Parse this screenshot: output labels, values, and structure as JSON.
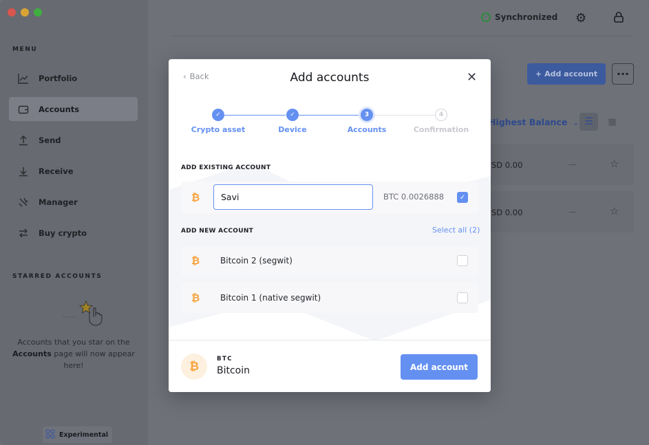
{
  "window": {
    "traffic_colors": [
      "#d8564d",
      "#d9a434",
      "#3fae41"
    ]
  },
  "sidebar": {
    "menu_title": "MENU",
    "items": [
      {
        "label": "Portfolio",
        "icon": "chart-line-icon"
      },
      {
        "label": "Accounts",
        "icon": "wallet-icon",
        "active": true
      },
      {
        "label": "Send",
        "icon": "arrow-up-icon"
      },
      {
        "label": "Receive",
        "icon": "arrow-down-icon"
      },
      {
        "label": "Manager",
        "icon": "tools-icon"
      },
      {
        "label": "Buy crypto",
        "icon": "exchange-icon"
      }
    ],
    "starred_title": "STARRED ACCOUNTS",
    "starred_text_1": "Accounts that you star on the",
    "starred_text_bold": "Accounts",
    "starred_text_2": "page will now appear here!",
    "experimental": "Experimental"
  },
  "topbar": {
    "sync_label": "Synchronized",
    "gear_icon": "gear-icon",
    "lock_icon": "lock-icon"
  },
  "accounts_page": {
    "add_account_label": "Add account",
    "more_label": "···",
    "sort_label": "Highest Balance",
    "rows": [
      {
        "balance": "SD 0.00",
        "change": "—"
      },
      {
        "balance": "SD 0.00",
        "change": "—"
      }
    ]
  },
  "modal": {
    "back_label": "Back",
    "title": "Add accounts",
    "steps": [
      {
        "label": "Crypto asset",
        "state": "done",
        "mark": "✓"
      },
      {
        "label": "Device",
        "state": "done",
        "mark": "✓"
      },
      {
        "label": "Accounts",
        "state": "current",
        "mark": "3"
      },
      {
        "label": "Confirmation",
        "state": "todo",
        "mark": "4"
      }
    ],
    "existing_label": "ADD EXISTING ACCOUNT",
    "existing": {
      "name_value": "Savi",
      "balance": "BTC 0.0026888",
      "checked": true
    },
    "new_label": "ADD NEW ACCOUNT",
    "select_all": "Select all (2)",
    "new_accounts": [
      {
        "name": "Bitcoin 2 (segwit)",
        "checked": false
      },
      {
        "name": "Bitcoin 1 (native segwit)",
        "checked": false
      }
    ],
    "footer": {
      "ticker": "BTC",
      "currency": "Bitcoin",
      "add_button": "Add account"
    },
    "colors": {
      "accent": "#6490f1",
      "btc": "#f7a23b"
    }
  }
}
